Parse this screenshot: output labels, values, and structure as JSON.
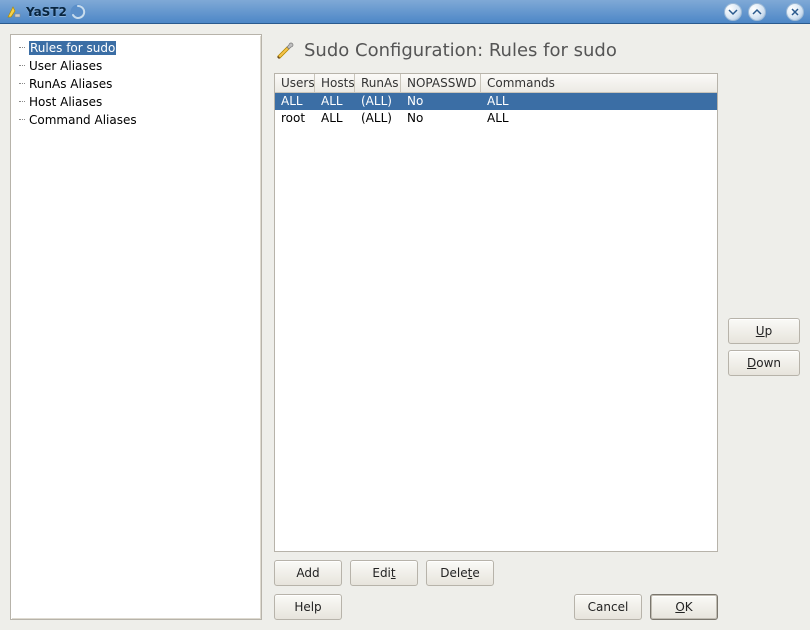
{
  "window": {
    "title": "YaST2"
  },
  "sidebar": {
    "items": [
      {
        "label": "Rules for sudo",
        "selected": true
      },
      {
        "label": "User Aliases",
        "selected": false
      },
      {
        "label": "RunAs Aliases",
        "selected": false
      },
      {
        "label": "Host Aliases",
        "selected": false
      },
      {
        "label": "Command Aliases",
        "selected": false
      }
    ]
  },
  "main": {
    "heading": "Sudo Configuration: Rules for sudo",
    "table": {
      "headers": {
        "users": "Users",
        "hosts": "Hosts",
        "runas": "RunAs",
        "nopasswd": "NOPASSWD",
        "commands": "Commands"
      },
      "rows": [
        {
          "users": "ALL",
          "hosts": "ALL",
          "runas": "(ALL)",
          "nopasswd": "No",
          "commands": "ALL",
          "selected": true
        },
        {
          "users": "root",
          "hosts": "ALL",
          "runas": "(ALL)",
          "nopasswd": "No",
          "commands": "ALL",
          "selected": false
        }
      ]
    },
    "side_buttons": {
      "up_underline": "U",
      "up_rest": "p",
      "down_underline": "D",
      "down_rest": "own"
    },
    "actions": {
      "add": "Add",
      "edi_prefix": "Edi",
      "edi_underline": "t",
      "dele_prefix": "Dele",
      "dele_underline": "t",
      "dele_suffix": "e"
    },
    "footer": {
      "help": "Help",
      "cancel": "Cancel",
      "ok_underline": "O",
      "ok_rest": "K"
    }
  }
}
